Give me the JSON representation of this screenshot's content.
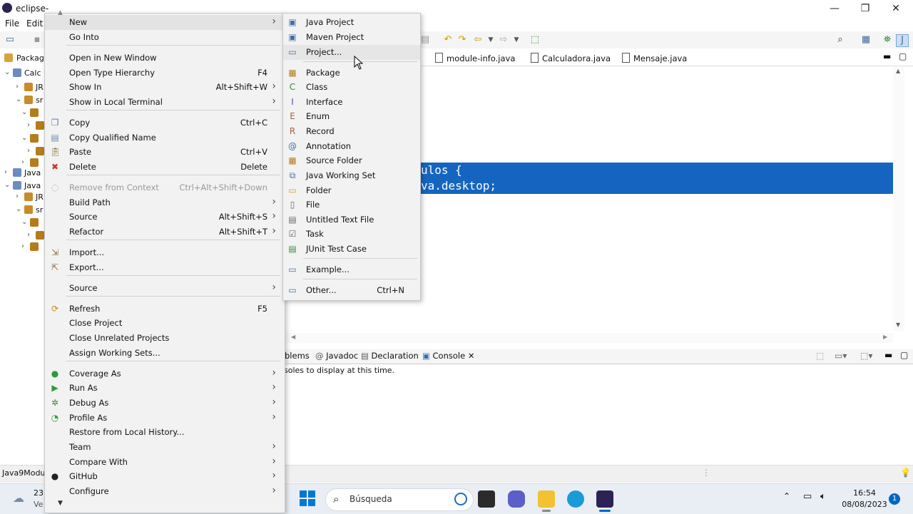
{
  "window": {
    "title": "eclipse-",
    "controls": [
      "—",
      "❐",
      "✕"
    ]
  },
  "menubar": [
    "File",
    "Edit"
  ],
  "explorer": {
    "header": "Package",
    "rows": [
      {
        "label": "Calc",
        "indent": 0,
        "expanded": true
      },
      {
        "label": "JR",
        "indent": 2,
        "expanded": false
      },
      {
        "label": "sr",
        "indent": 2,
        "expanded": true
      },
      {
        "label": "",
        "indent": 3,
        "expanded": true
      },
      {
        "label": "",
        "indent": 4,
        "expanded": false
      },
      {
        "label": "",
        "indent": 3,
        "expanded": true
      },
      {
        "label": "",
        "indent": 4,
        "expanded": false
      },
      {
        "label": "",
        "indent": 3,
        "expanded": false
      },
      {
        "label": "Java",
        "indent": 0,
        "expanded": false
      },
      {
        "label": "Java",
        "indent": 0,
        "expanded": true
      },
      {
        "label": "JR",
        "indent": 2,
        "expanded": false
      },
      {
        "label": "sr",
        "indent": 2,
        "expanded": true
      },
      {
        "label": "",
        "indent": 3,
        "expanded": true
      },
      {
        "label": "",
        "indent": 4,
        "expanded": false
      },
      {
        "label": "",
        "indent": 3,
        "expanded": false
      }
    ]
  },
  "editor": {
    "tabs": [
      "module-info.java",
      "Calculadora.java",
      "Mensaje.java"
    ],
    "lines": [
      "ulos {",
      "va.desktop;"
    ]
  },
  "console": {
    "tabs": [
      "blems",
      "Javadoc",
      "Declaration",
      "Console"
    ],
    "message": "soles to display at this time."
  },
  "statusbar": {
    "left": "Java9Modul"
  },
  "context_menu": {
    "items": [
      {
        "label": "New",
        "shortcut": "",
        "submenu": true,
        "icon": "",
        "highlighted": true
      },
      {
        "label": "Go Into",
        "shortcut": "",
        "submenu": false,
        "icon": ""
      },
      {
        "sep": true
      },
      {
        "label": "Open in New Window",
        "shortcut": "",
        "submenu": false,
        "icon": ""
      },
      {
        "label": "Open Type Hierarchy",
        "shortcut": "F4",
        "submenu": false,
        "icon": ""
      },
      {
        "label": "Show In",
        "shortcut": "Alt+Shift+W",
        "submenu": true,
        "icon": ""
      },
      {
        "label": "Show in Local Terminal",
        "shortcut": "",
        "submenu": true,
        "icon": ""
      },
      {
        "sep": true
      },
      {
        "label": "Copy",
        "shortcut": "Ctrl+C",
        "submenu": false,
        "icon": "copy-icon"
      },
      {
        "label": "Copy Qualified Name",
        "shortcut": "",
        "submenu": false,
        "icon": "copy-qualified-icon"
      },
      {
        "label": "Paste",
        "shortcut": "Ctrl+V",
        "submenu": false,
        "icon": "paste-icon"
      },
      {
        "label": "Delete",
        "shortcut": "Delete",
        "submenu": false,
        "icon": "delete-icon"
      },
      {
        "sep": true
      },
      {
        "label": "Remove from Context",
        "shortcut": "Ctrl+Alt+Shift+Down",
        "submenu": false,
        "icon": "remove-context-icon",
        "disabled": true
      },
      {
        "label": "Build Path",
        "shortcut": "",
        "submenu": true,
        "icon": ""
      },
      {
        "label": "Source",
        "shortcut": "Alt+Shift+S",
        "submenu": true,
        "icon": ""
      },
      {
        "label": "Refactor",
        "shortcut": "Alt+Shift+T",
        "submenu": true,
        "icon": ""
      },
      {
        "sep": true
      },
      {
        "label": "Import...",
        "shortcut": "",
        "submenu": false,
        "icon": "import-icon"
      },
      {
        "label": "Export...",
        "shortcut": "",
        "submenu": false,
        "icon": "export-icon"
      },
      {
        "sep": true
      },
      {
        "label": "Source",
        "shortcut": "",
        "submenu": true,
        "icon": ""
      },
      {
        "sep": true
      },
      {
        "label": "Refresh",
        "shortcut": "F5",
        "submenu": false,
        "icon": "refresh-icon"
      },
      {
        "label": "Close Project",
        "shortcut": "",
        "submenu": false,
        "icon": ""
      },
      {
        "label": "Close Unrelated Projects",
        "shortcut": "",
        "submenu": false,
        "icon": ""
      },
      {
        "label": "Assign Working Sets...",
        "shortcut": "",
        "submenu": false,
        "icon": ""
      },
      {
        "sep": true
      },
      {
        "label": "Coverage As",
        "shortcut": "",
        "submenu": true,
        "icon": "coverage-icon"
      },
      {
        "label": "Run As",
        "shortcut": "",
        "submenu": true,
        "icon": "run-icon"
      },
      {
        "label": "Debug As",
        "shortcut": "",
        "submenu": true,
        "icon": "debug-icon"
      },
      {
        "label": "Profile As",
        "shortcut": "",
        "submenu": true,
        "icon": "profile-icon"
      },
      {
        "label": "Restore from Local History...",
        "shortcut": "",
        "submenu": false,
        "icon": ""
      },
      {
        "label": "Team",
        "shortcut": "",
        "submenu": true,
        "icon": ""
      },
      {
        "label": "Compare With",
        "shortcut": "",
        "submenu": true,
        "icon": ""
      },
      {
        "label": "GitHub",
        "shortcut": "",
        "submenu": true,
        "icon": "github-icon"
      },
      {
        "label": "Configure",
        "shortcut": "",
        "submenu": true,
        "icon": ""
      }
    ]
  },
  "new_submenu": {
    "items": [
      {
        "label": "Java Project",
        "shortcut": "",
        "icon": "java-project-icon"
      },
      {
        "label": "Maven Project",
        "shortcut": "",
        "icon": "maven-project-icon"
      },
      {
        "label": "Project...",
        "shortcut": "",
        "icon": "project-icon",
        "highlighted": true
      },
      {
        "sep": true
      },
      {
        "label": "Package",
        "shortcut": "",
        "icon": "package-icon"
      },
      {
        "label": "Class",
        "shortcut": "",
        "icon": "class-icon"
      },
      {
        "label": "Interface",
        "shortcut": "",
        "icon": "interface-icon"
      },
      {
        "label": "Enum",
        "shortcut": "",
        "icon": "enum-icon"
      },
      {
        "label": "Record",
        "shortcut": "",
        "icon": "record-icon"
      },
      {
        "label": "Annotation",
        "shortcut": "",
        "icon": "annotation-icon"
      },
      {
        "label": "Source Folder",
        "shortcut": "",
        "icon": "source-folder-icon"
      },
      {
        "label": "Java Working Set",
        "shortcut": "",
        "icon": "working-set-icon"
      },
      {
        "label": "Folder",
        "shortcut": "",
        "icon": "folder-icon"
      },
      {
        "label": "File",
        "shortcut": "",
        "icon": "file-icon"
      },
      {
        "label": "Untitled Text File",
        "shortcut": "",
        "icon": "text-file-icon"
      },
      {
        "label": "Task",
        "shortcut": "",
        "icon": "task-icon"
      },
      {
        "label": "JUnit Test Case",
        "shortcut": "",
        "icon": "junit-icon"
      },
      {
        "sep": true
      },
      {
        "label": "Example...",
        "shortcut": "",
        "icon": "example-icon"
      },
      {
        "sep": true
      },
      {
        "label": "Other...",
        "shortcut": "Ctrl+N",
        "icon": "other-icon"
      }
    ]
  },
  "taskbar": {
    "weather_temp": "23'",
    "weather_text": "Ve",
    "search_placeholder": "Búsqueda",
    "time": "16:54",
    "date": "08/08/2023",
    "notifications": "1"
  },
  "colors": {
    "selection": "#1565c0",
    "menu_bg": "#f2f2f2",
    "taskbar_bg": "#e9eef4",
    "windows_blue": "#0078d4"
  }
}
